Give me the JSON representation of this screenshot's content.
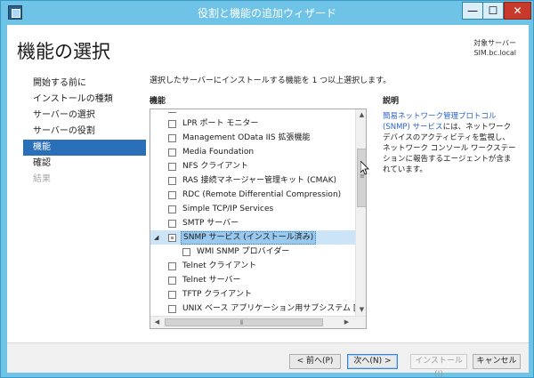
{
  "window": {
    "title": "役割と機能の追加ウィザード",
    "minimize_label": "—",
    "maximize_label": "☐",
    "close_label": "✕"
  },
  "page_title": "機能の選択",
  "server": {
    "label": "対象サーバー",
    "name": "SIM.bc.local"
  },
  "nav": [
    {
      "label": "開始する前に",
      "state": "normal"
    },
    {
      "label": "インストールの種類",
      "state": "normal"
    },
    {
      "label": "サーバーの選択",
      "state": "normal"
    },
    {
      "label": "サーバーの役割",
      "state": "normal"
    },
    {
      "label": "機能",
      "state": "active"
    },
    {
      "label": "確認",
      "state": "normal"
    },
    {
      "label": "結果",
      "state": "disabled"
    }
  ],
  "instruction": "選択したサーバーにインストールする機能を 1 つ以上選択します。",
  "features_header": "機能",
  "description_header": "説明",
  "features": [
    {
      "label": "LPR ポート モニター",
      "checked": false
    },
    {
      "label": "Management OData IIS 拡張機能",
      "checked": false
    },
    {
      "label": "Media Foundation",
      "checked": false
    },
    {
      "label": "NFS クライアント",
      "checked": false
    },
    {
      "label": "RAS 接続マネージャー管理キット (CMAK)",
      "checked": false
    },
    {
      "label": "RDC (Remote Differential Compression)",
      "checked": false
    },
    {
      "label": "Simple TCP/IP Services",
      "checked": false
    },
    {
      "label": "SMTP サーバー",
      "checked": false
    },
    {
      "label": "SNMP サービス (インストール済み)",
      "checked": "partial",
      "expanded": true,
      "selected": true
    },
    {
      "label": "WMI SNMP プロバイダー",
      "checked": false,
      "child": true
    },
    {
      "label": "Telnet クライアント",
      "checked": false
    },
    {
      "label": "Telnet サーバー",
      "checked": false
    },
    {
      "label": "TFTP クライアント",
      "checked": false
    },
    {
      "label": "UNIX ベース アプリケーション用サブシステム [非推奨]",
      "checked": false
    }
  ],
  "description": {
    "link_text": "簡易ネットワーク管理プロトコル (SNMP) サービス",
    "rest": "には、ネットワーク デバイスのアクティビティを監視し、ネットワーク コンソール ワークステーションに報告するエージェントが含まれています。"
  },
  "buttons": {
    "prev": "< 前へ(P)",
    "next": "次へ(N) >",
    "install": "インストール(I)",
    "cancel": "キャンセル"
  },
  "icons": {
    "expander": "triangle-down-icon",
    "scroll_up": "chevron-up-icon",
    "scroll_down": "chevron-down-icon",
    "scroll_left": "chevron-left-icon",
    "scroll_right": "chevron-right-icon"
  }
}
